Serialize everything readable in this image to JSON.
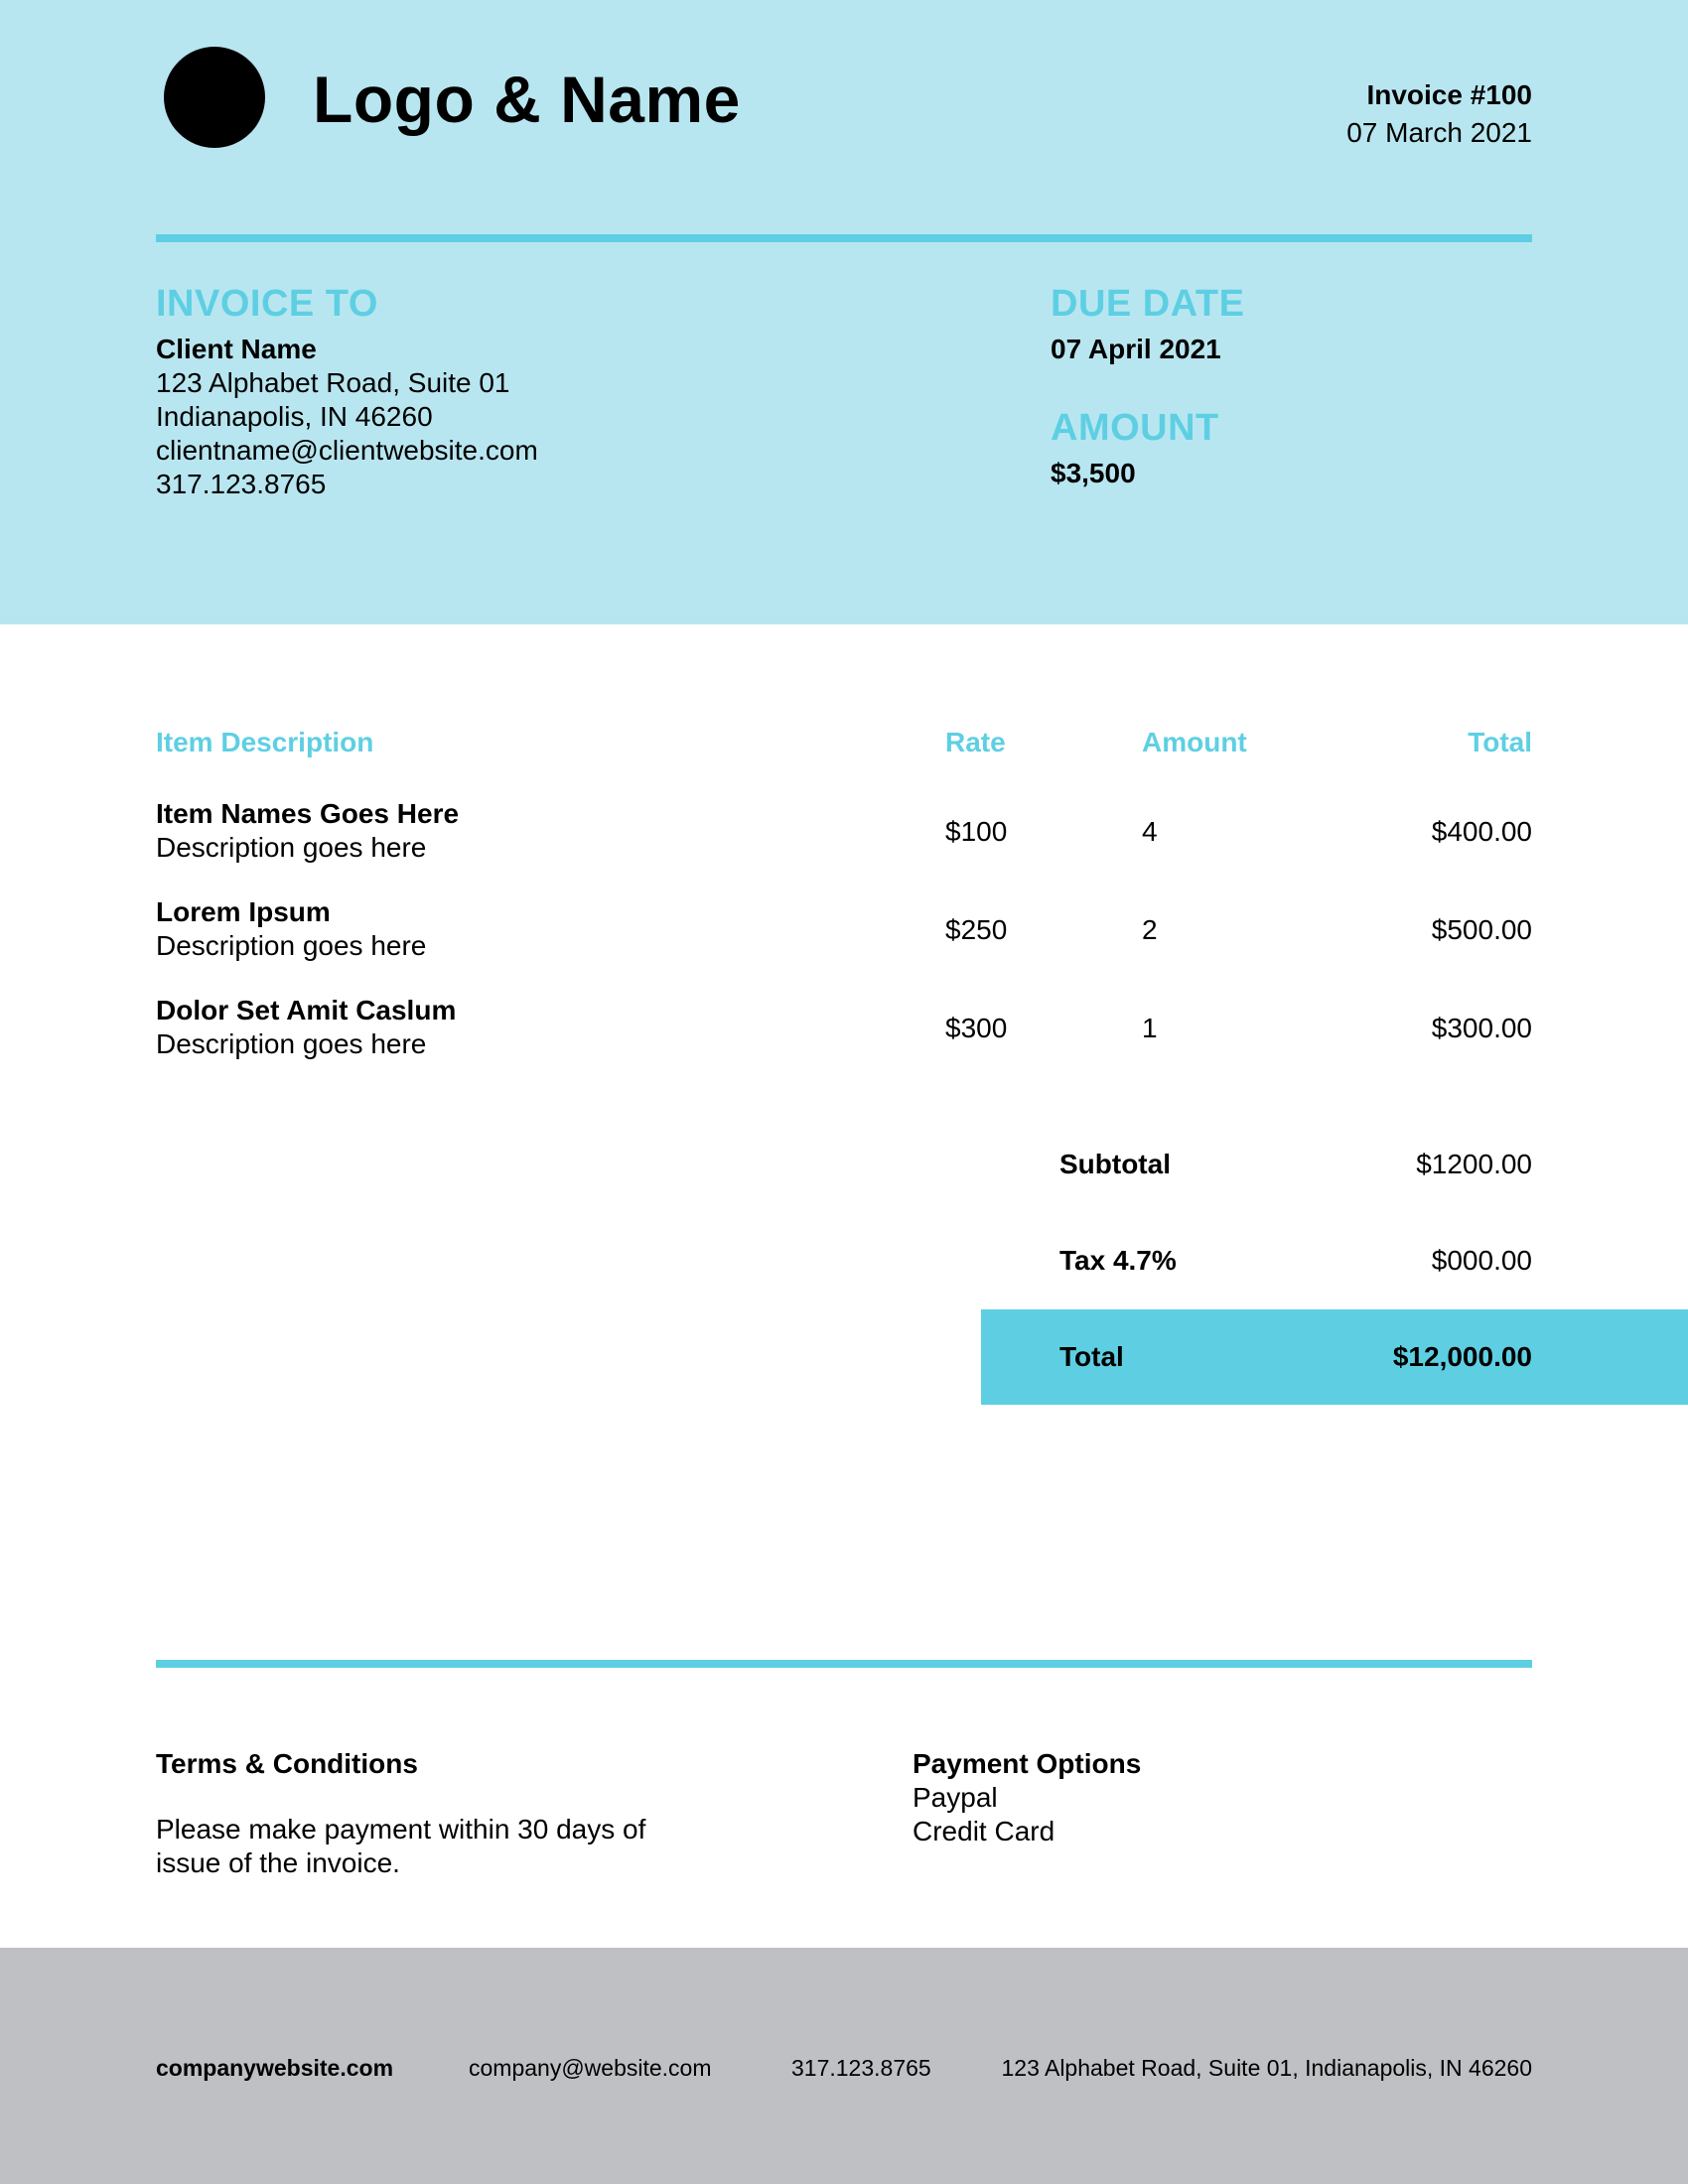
{
  "header": {
    "logo_name": "Logo & Name",
    "invoice_number": "Invoice #100",
    "invoice_date": "07 March 2021"
  },
  "invoice_to": {
    "heading": "INVOICE TO",
    "client_name": "Client Name",
    "address_line1": "123 Alphabet Road, Suite 01",
    "address_line2": "Indianapolis, IN 46260",
    "email": "clientname@clientwebsite.com",
    "phone": "317.123.8765"
  },
  "due": {
    "heading": "DUE DATE",
    "date": "07 April 2021"
  },
  "amount": {
    "heading": "AMOUNT",
    "value": "$3,500"
  },
  "table": {
    "headers": {
      "description": "Item Description",
      "rate": "Rate",
      "amount": "Amount",
      "total": "Total"
    },
    "rows": [
      {
        "name": "Item Names Goes Here",
        "description": "Description goes here",
        "rate": "$100",
        "qty": "4",
        "total": "$400.00"
      },
      {
        "name": "Lorem Ipsum",
        "description": "Description goes here",
        "rate": "$250",
        "qty": "2",
        "total": "$500.00"
      },
      {
        "name": "Dolor Set Amit Caslum",
        "description": "Description goes here",
        "rate": "$300",
        "qty": "1",
        "total": "$300.00"
      }
    ]
  },
  "summary": {
    "subtotal_label": "Subtotal",
    "subtotal_value": "$1200.00",
    "tax_label": "Tax 4.7%",
    "tax_value": "$000.00",
    "total_label": "Total",
    "total_value": "$12,000.00"
  },
  "terms": {
    "heading": "Terms & Conditions",
    "line1": "Please make payment within 30 days of",
    "line2": "issue of the invoice."
  },
  "payment": {
    "heading": "Payment Options",
    "options": [
      "Paypal",
      "Credit Card"
    ]
  },
  "footer": {
    "website": "companywebsite.com",
    "email": "company@website.com",
    "phone": "317.123.8765",
    "address": "123 Alphabet Road, Suite 01, Indianapolis, IN 46260"
  },
  "colors": {
    "header_bg": "#b8e6f0",
    "accent": "#5ecfe3",
    "footer_bg": "#bec0c4"
  }
}
